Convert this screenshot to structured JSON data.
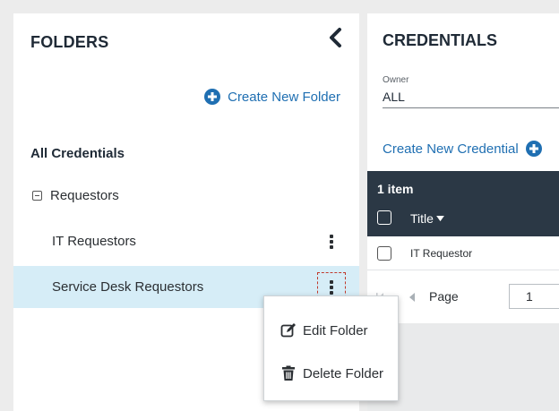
{
  "folders": {
    "title": "FOLDERS",
    "create_label": "Create New Folder",
    "all_credentials": "All Credentials",
    "group": "Requestors",
    "items": [
      "IT Requestors",
      "Service Desk Requestors"
    ]
  },
  "context_menu": {
    "edit": "Edit Folder",
    "delete": "Delete Folder"
  },
  "credentials": {
    "title": "CREDENTIALS",
    "owner_label": "Owner",
    "owner_value": "ALL",
    "create_label": "Create New Credential",
    "item_count": "1 item",
    "column_title": "Title",
    "rows": [
      "IT Requestor"
    ],
    "page_label": "Page",
    "page_value": "1"
  },
  "colors": {
    "accent": "#1f6fb2",
    "selected_row": "#d6edf7",
    "grid_header": "#2b3845"
  }
}
